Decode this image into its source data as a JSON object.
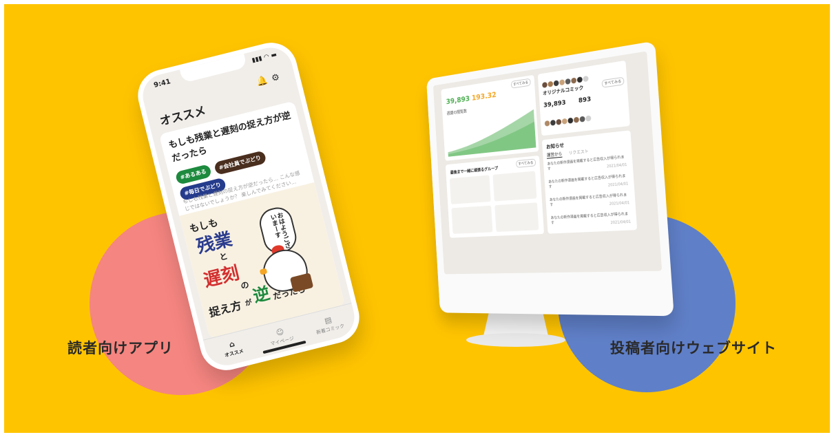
{
  "captions": {
    "reader_app": "読者向けアプリ",
    "creator_web": "投稿者向けウェブサイト"
  },
  "phone": {
    "time": "9:41",
    "status": "▮▮▮ ◠ ▬",
    "header_icons": "🔔⚙",
    "title": "オススメ",
    "card": {
      "title": "もしも残業と遅刻の捉え方が逆だったら",
      "tags": [
        "#会社員でぶどり",
        "#毎日でぶどり",
        "#あるある"
      ],
      "description": "もしも残業と遅刻の捉え方が逆だったら… こんな感じではないでしょうか？ 楽しんでみてください…"
    },
    "art": {
      "line1": "もしも",
      "line2": "残業",
      "line3": "と",
      "line4": "遅刻",
      "line5": "の",
      "line6": "捉え方",
      "line7": "が",
      "line8": "逆",
      "line9": "だったら",
      "bubble": "おはようございまーす"
    },
    "tabs": [
      {
        "label": "オススメ",
        "icon": "⌂"
      },
      {
        "label": "マイページ",
        "icon": "☺"
      },
      {
        "label": "新着コミック",
        "icon": "▤"
      }
    ]
  },
  "monitor": {
    "see_all": "すべてみる",
    "stat1": "39,893",
    "stat2": "193.32",
    "chart_label": "週間の閲覧数",
    "groups_title": "最後まで一緒に頑張るグループ",
    "original_comic": "オリジナルコミック",
    "comic_stat1": "39,893",
    "comic_stat2": "893",
    "notice_title": "お知らせ",
    "notice_tabs": [
      "運営から",
      "リクエスト"
    ],
    "notice_date": "2021/04/01",
    "notice_text": "あなたの新作漫画を掲載すると広告収入が得られます",
    "avatar_colors": [
      "#6B4E3D",
      "#A5794E",
      "#3C3C3C",
      "#C9A27A",
      "#5A5A5A",
      "#8C6A4E",
      "#2E2E2E",
      "#B08A66",
      "#D0D0D0"
    ]
  }
}
